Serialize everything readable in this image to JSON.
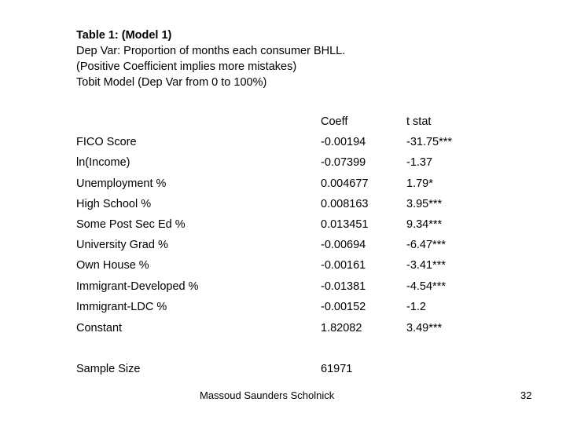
{
  "header": {
    "title": "Table 1: (Model 1)",
    "lines": [
      "Dep Var: Proportion of months each consumer BHLL.",
      "(Positive Coefficient implies more mistakes)",
      "Tobit Model (Dep Var from 0 to 100%)"
    ]
  },
  "table": {
    "columns": {
      "label": "",
      "coeff": "Coeff",
      "tstat": "t stat"
    },
    "rows": [
      {
        "label": "FICO Score",
        "coeff": "-0.00194",
        "tstat": "-31.75***"
      },
      {
        "label": "ln(Income)",
        "coeff": "-0.07399",
        "tstat": "-1.37"
      },
      {
        "label": "Unemployment %",
        "coeff": "0.004677",
        "tstat": "1.79*"
      },
      {
        "label": "High School %",
        "coeff": "0.008163",
        "tstat": "3.95***"
      },
      {
        "label": "Some Post Sec Ed %",
        "coeff": "0.013451",
        "tstat": "9.34***"
      },
      {
        "label": "University Grad %",
        "coeff": "-0.00694",
        "tstat": "-6.47***"
      },
      {
        "label": "Own House %",
        "coeff": "-0.00161",
        "tstat": "-3.41***"
      },
      {
        "label": "Immigrant-Developed %",
        "coeff": "-0.01381",
        "tstat": "-4.54***"
      },
      {
        "label": "Immigrant-LDC %",
        "coeff": "-0.00152",
        "tstat": "-1.2"
      },
      {
        "label": "Constant",
        "coeff": "1.82082",
        "tstat": "3.49***"
      }
    ],
    "sample_size": {
      "label": "Sample Size",
      "value": "61971"
    }
  },
  "footer": {
    "authors": "Massoud Saunders Scholnick",
    "page_number": "32"
  }
}
